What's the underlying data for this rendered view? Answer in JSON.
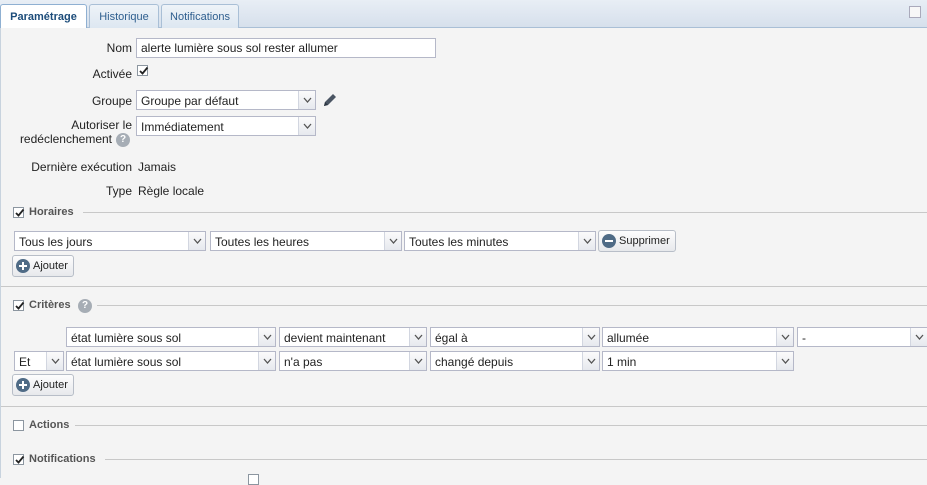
{
  "tabs": [
    {
      "label": "Paramétrage",
      "active": true
    },
    {
      "label": "Historique",
      "active": false
    },
    {
      "label": "Notifications",
      "active": false
    }
  ],
  "form": {
    "name_label": "Nom",
    "name_value": "alerte lumière sous sol rester allumer",
    "active_label": "Activée",
    "active_checked": true,
    "group_label": "Groupe",
    "group_value": "Groupe par défaut",
    "retrigger_label_1": "Autoriser le",
    "retrigger_label_2": "redéclenchement",
    "retrigger_value": "Immédiatement",
    "last_exec_label": "Dernière exécution",
    "last_exec_value": "Jamais",
    "type_label": "Type",
    "type_value": "Règle locale"
  },
  "horaires": {
    "title": "Horaires",
    "checked": true,
    "day": "Tous les jours",
    "hour": "Toutes les heures",
    "minute": "Toutes les minutes",
    "delete_label": "Supprimer",
    "add_label": "Ajouter"
  },
  "criteres": {
    "title": "Critères",
    "checked": true,
    "rows": [
      {
        "conj": "",
        "device": "état lumière sous sol",
        "op": "devient maintenant",
        "cmp": "égal à",
        "value": "allumée",
        "extra": "-"
      },
      {
        "conj": "Et",
        "device": "état lumière sous sol",
        "op": "n'a pas",
        "cmp": "changé depuis",
        "value": "1 min"
      }
    ],
    "add_label": "Ajouter"
  },
  "actions": {
    "title": "Actions",
    "checked": false
  },
  "notifications": {
    "title": "Notifications",
    "checked": true
  },
  "colors": {
    "accent": "#1c4c7a",
    "tab_border": "#a9bfd6"
  }
}
